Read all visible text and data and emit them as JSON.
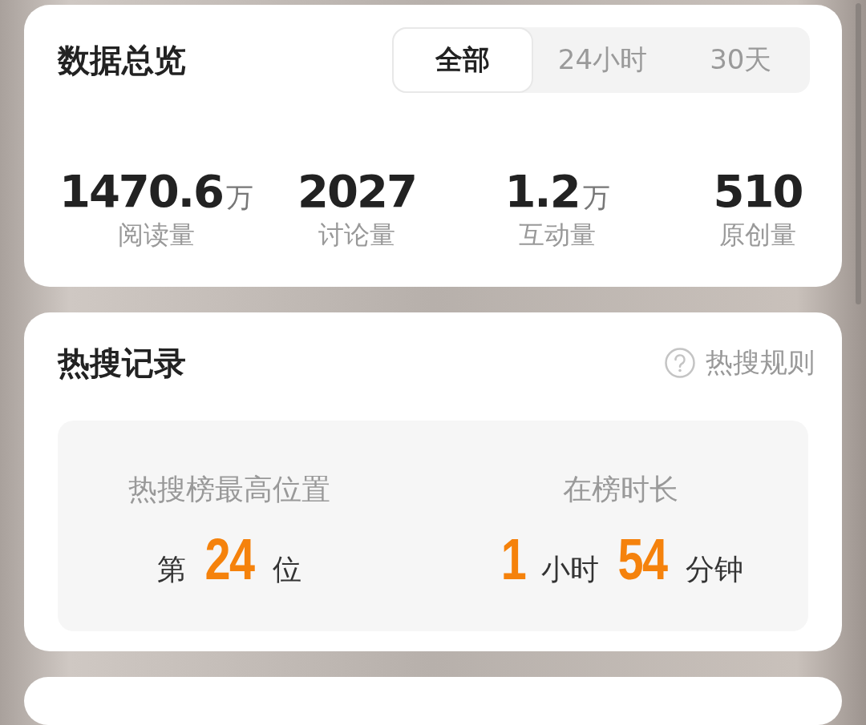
{
  "overview": {
    "title": "数据总览",
    "tabs": [
      {
        "label": "全部",
        "selected": true
      },
      {
        "label": "24小时",
        "selected": false
      },
      {
        "label": "30天",
        "selected": false
      }
    ],
    "stats": [
      {
        "value": "1470.6",
        "unit": "万",
        "label": "阅读量"
      },
      {
        "value": "2027",
        "label": "讨论量"
      },
      {
        "value": "1.2",
        "unit": "万",
        "label": "互动量"
      },
      {
        "value": "510",
        "label": "原创量"
      }
    ]
  },
  "hot_search": {
    "title": "热搜记录",
    "rules_link": "热搜规则",
    "records": [
      {
        "label": "热搜榜最高位置",
        "parts": [
          {
            "kind": "text",
            "text": "第"
          },
          {
            "kind": "number",
            "text": "24"
          },
          {
            "kind": "text",
            "text": "位"
          }
        ]
      },
      {
        "label": "在榜时长",
        "parts": [
          {
            "kind": "number",
            "text": "1"
          },
          {
            "kind": "text",
            "text": "小时"
          },
          {
            "kind": "number",
            "text": "54"
          },
          {
            "kind": "text",
            "text": "分钟"
          }
        ]
      }
    ]
  }
}
